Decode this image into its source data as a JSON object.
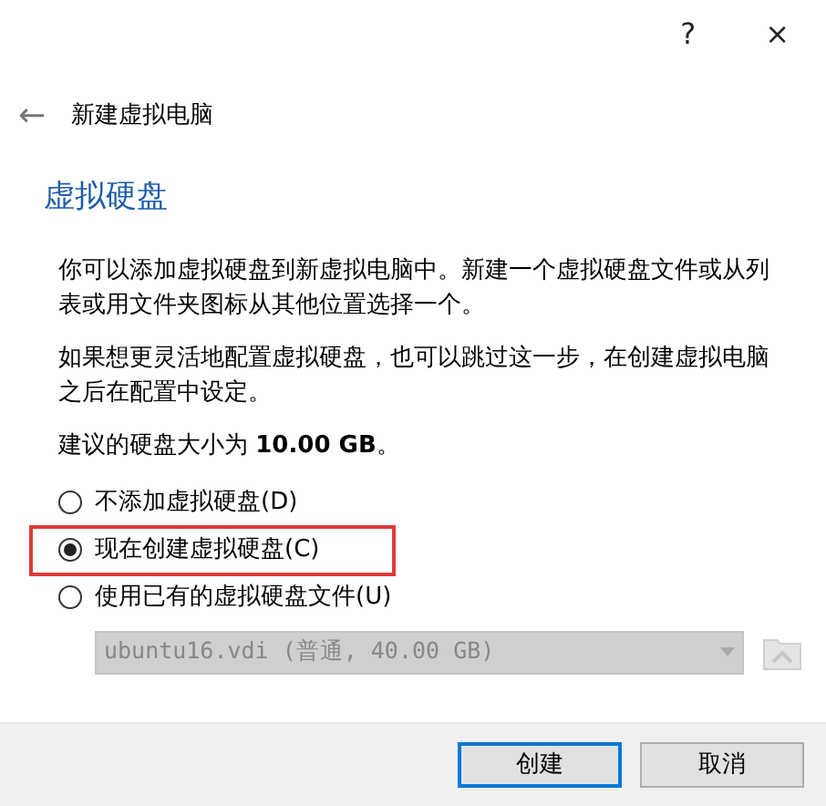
{
  "window": {
    "help": "?",
    "close": "×"
  },
  "header": {
    "back": "←",
    "title": "新建虚拟电脑"
  },
  "heading": "虚拟硬盘",
  "paragraphs": [
    "你可以添加虚拟硬盘到新虚拟电脑中。新建一个虚拟硬盘文件或从列表或用文件夹图标从其他位置选择一个。",
    "如果想更灵活地配置虚拟硬盘，也可以跳过这一步，在创建虚拟电脑之后在配置中设定。",
    "建议的硬盘大小为 **10.00 GB**。"
  ],
  "options": [
    {
      "label": "不添加虚拟硬盘(D)",
      "selected": false,
      "highlighted": false
    },
    {
      "label": "现在创建虚拟硬盘(C)",
      "selected": true,
      "highlighted": true
    },
    {
      "label": "使用已有的虚拟硬盘文件(U)",
      "selected": false,
      "highlighted": false
    }
  ],
  "disk_select": {
    "value": "ubuntu16.vdi (普通, 40.00 GB)",
    "disabled": true
  },
  "buttons": [
    {
      "label": "创建",
      "default": true
    },
    {
      "label": "取消",
      "default": false
    }
  ]
}
